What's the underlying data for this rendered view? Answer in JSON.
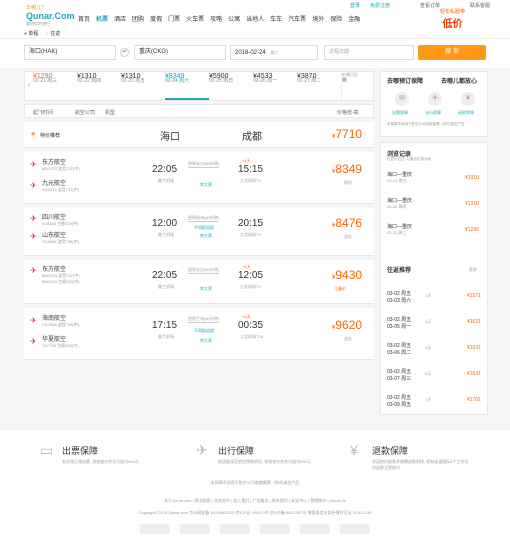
{
  "top": {
    "city": "去哪儿?",
    "links": [
      "登录",
      "免费注册",
      "查看订单",
      "联系客服"
    ]
  },
  "logo": {
    "name": "Qunar.Com",
    "sub": "聪明你的旅行"
  },
  "nav": [
    "首页",
    "机票",
    "酒店",
    "团购",
    "度假",
    "门票",
    "火车票",
    "攻略",
    "公寓",
    "当地人",
    "车车",
    "汽车票",
    "境外",
    "保险",
    "金融"
  ],
  "promo": {
    "line1": "轻松私服带",
    "line2": "低价"
  },
  "trip": {
    "oneway": "单程",
    "round": "往返"
  },
  "search": {
    "from": "海口(HAK)",
    "to": "重庆(CKG)",
    "date": "2018-02-24",
    "weekday": "周六",
    "return_placeholder": "返程日期",
    "button": "搜 索"
  },
  "dates": [
    {
      "d": "02-21 周三",
      "p": "¥1290"
    },
    {
      "d": "02-22 周四",
      "p": "¥1310"
    },
    {
      "d": "02-23 周五",
      "p": "¥1310"
    },
    {
      "d": "02-24 周六",
      "p": "¥8349"
    },
    {
      "d": "02-25 周日",
      "p": "¥5900"
    },
    {
      "d": "02-26 周一",
      "p": "¥4533"
    },
    {
      "d": "02-27 周二",
      "p": "¥3870"
    }
  ],
  "calendar": "价格日历",
  "filters": [
    "起飞时间",
    "航空公司",
    "机型"
  ],
  "sort": "价格低-高",
  "recommend": {
    "label": "特价推荐",
    "from": "海口",
    "to": "成都",
    "price": "7710"
  },
  "flights": [
    {
      "a1": "东方航空",
      "a1s": "MU2278 波音737(中)",
      "a2": "九元航空",
      "a2s": "AQ1074 波音737(中)",
      "dep": "22:05",
      "dap": "美兰机场",
      "stop": "经停长沙(60分钟)",
      "arr": "15:15",
      "arap": "江北机场T3",
      "next": "+1天",
      "trans": "转机",
      "tag": "转大票",
      "price": "8349"
    },
    {
      "a1": "四川航空",
      "a1s": "3U8183 空客320(中)",
      "a2": "山东航空",
      "a2s": "SC8866 波音738(中)",
      "dep": "12:00",
      "dap": "美兰机场",
      "stop": "经停杭州(40分钟)",
      "arr": "20:15",
      "arap": "江北机场T3",
      "next": "",
      "trans": "不同航站楼",
      "tag": "转大票",
      "price": "8476"
    },
    {
      "a1": "东方航空",
      "a1s": "MU2278 波音737(中)",
      "a2": "",
      "a2s": "MU2244 空客320(中)",
      "dep": "22:05",
      "dap": "美兰机场",
      "stop": "经停长沙(60分钟)",
      "arr": "12:05",
      "arap": "江北机场T3",
      "next": "+1天",
      "trans": "",
      "tag": "转大票",
      "price": "9430"
    },
    {
      "a1": "海南航空",
      "a1s": "HU7855 波音738(中)",
      "a2": "华夏航空",
      "a2s": "G52750 空客320(中)",
      "dep": "17:15",
      "dap": "美兰机场",
      "stop": "经停兰州(60分钟)",
      "arr": "00:35",
      "arap": "江北机场T2A",
      "next": "+1天",
      "trans": "不同航站楼",
      "tag": "转大票",
      "price": "9620"
    }
  ],
  "side": {
    "guarantee_title": "去哪预订保障",
    "guarantee_sub": "去哪儿都放心",
    "g_items": [
      "出票保障",
      "出行保障",
      "退款保障"
    ],
    "g_note": "本保障不适用于航空公司商旅客票, 1秒约退还产品",
    "history_title": "浏览记录",
    "history_note": "仅显示近日, 以最近记录为准",
    "history": [
      {
        "r": "海口—重庆",
        "d": "02-23 周五",
        "p": "¥1310"
      },
      {
        "r": "海口—重庆",
        "d": "02-22 周四",
        "p": "¥1310"
      },
      {
        "r": "海口—重庆",
        "d": "02-21 周三",
        "p": "¥1290"
      }
    ],
    "rt_title": "往返推荐",
    "more": "更多",
    "rt": [
      {
        "d1": "03-02 周五",
        "d2": "03-03 周六",
        "n": "1天",
        "p": "¥1571"
      },
      {
        "d1": "03-02 周五",
        "d2": "03-05 周一",
        "n": "3天",
        "p": "¥1631"
      },
      {
        "d1": "03-02 周五",
        "d2": "03-06 周二",
        "n": "4天",
        "p": "¥1631"
      },
      {
        "d1": "03-02 周五",
        "d2": "03-07 周三",
        "n": "5天",
        "p": "¥1631"
      },
      {
        "d1": "03-02 周五",
        "d2": "03-09 周五",
        "n": "7天",
        "p": "¥1701"
      }
    ]
  },
  "footer": {
    "items": [
      {
        "t": "出票保障",
        "s": "若未按正常出票, 承担差价并先行赔付500元"
      },
      {
        "t": "出行保障",
        "s": "航班延误至航空停航转机, 承担差价并先行赔付500元"
      },
      {
        "t": "退款保障",
        "s": "承诺按约退款并保障退款到帐, 如有延误国际4个工作日内退款立即赔付"
      }
    ],
    "note": "本保障不适用于航空公司商旅客票, 1秒约退还产品",
    "links": "关于Qunar.com | 营业执照 | 业务合作 | 加入我们 | 广告服务 | 联系我们 | 安全中心 | 营销统计 | About Us",
    "copy": "Copyright©2018 Qunar.com  京公网安备 11010802030 京ICP证 050014号  京ICP备05021087号  增值电信业务经营许可证 2016-0110"
  }
}
